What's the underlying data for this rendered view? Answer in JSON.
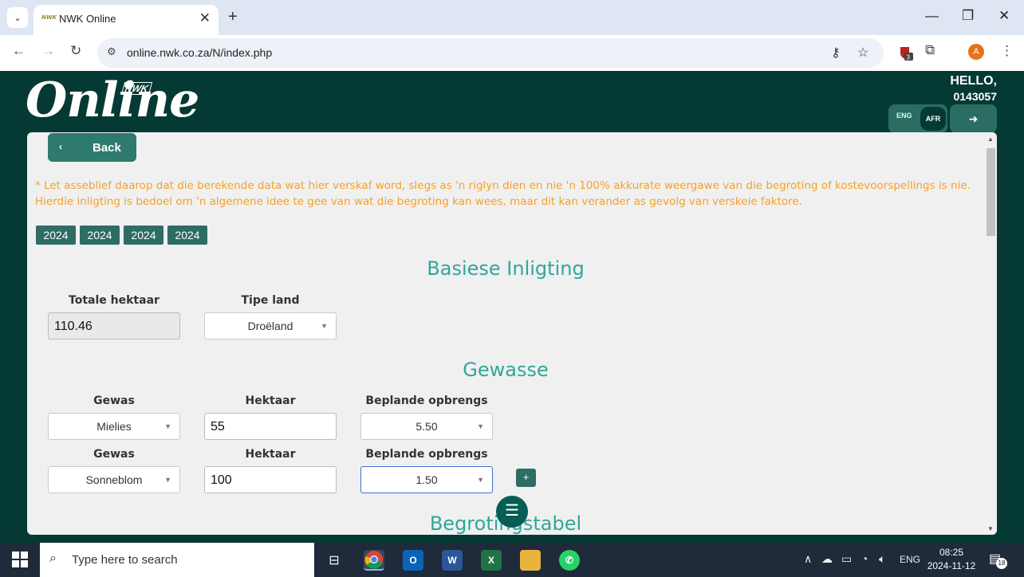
{
  "browser": {
    "tab_title": "NWK Online",
    "url": "online.nwk.co.za/N/index.php",
    "profile_initial": "A",
    "extension_badge": "3"
  },
  "header": {
    "logo_text": "Online",
    "logo_brand": "NWK",
    "hello": "HELLO,",
    "user_id": "0143057",
    "lang_eng": "ENG",
    "lang_afr": "AFR",
    "active_language": "AFR"
  },
  "page": {
    "back_label": "Back",
    "disclaimer": "* Let asseblief daarop dat die berekende data wat hier verskaf word, slegs as 'n riglyn dien en nie 'n 100% akkurate weergawe van die begroting of kostevoorspellings is nie. Hierdie inligting is bedoel om 'n algemene idee te gee van wat die begroting kan wees, maar dit kan verander as gevolg van verskeie faktore.",
    "years": [
      "2024",
      "2024",
      "2024",
      "2024"
    ],
    "basic_info": {
      "heading": "Basiese Inligting",
      "total_ha_label": "Totale hektaar",
      "total_ha_value": "110.46",
      "land_type_label": "Tipe land",
      "land_type_value": "Droëland"
    },
    "crops": {
      "heading": "Gewasse",
      "rows": [
        {
          "crop_label": "Gewas",
          "crop_value": "Mielies",
          "ha_label": "Hektaar",
          "ha_value": "55",
          "yield_label": "Beplande opbrengs",
          "yield_value": "5.50"
        },
        {
          "crop_label": "Gewas",
          "crop_value": "Sonneblom",
          "ha_label": "Hektaar",
          "ha_value": "100",
          "yield_label": "Beplande opbrengs",
          "yield_value": "1.50"
        }
      ],
      "add_label": "+"
    },
    "budget_heading": "Begrotingstabel"
  },
  "taskbar": {
    "search_placeholder": "Type here to search",
    "language": "ENG",
    "time": "08:25",
    "date": "2024-11-12",
    "notification_count": "18"
  },
  "colors": {
    "brand_dark": "#053a34",
    "accent_teal": "#2fa79a",
    "warning_orange": "#f3a12a"
  }
}
